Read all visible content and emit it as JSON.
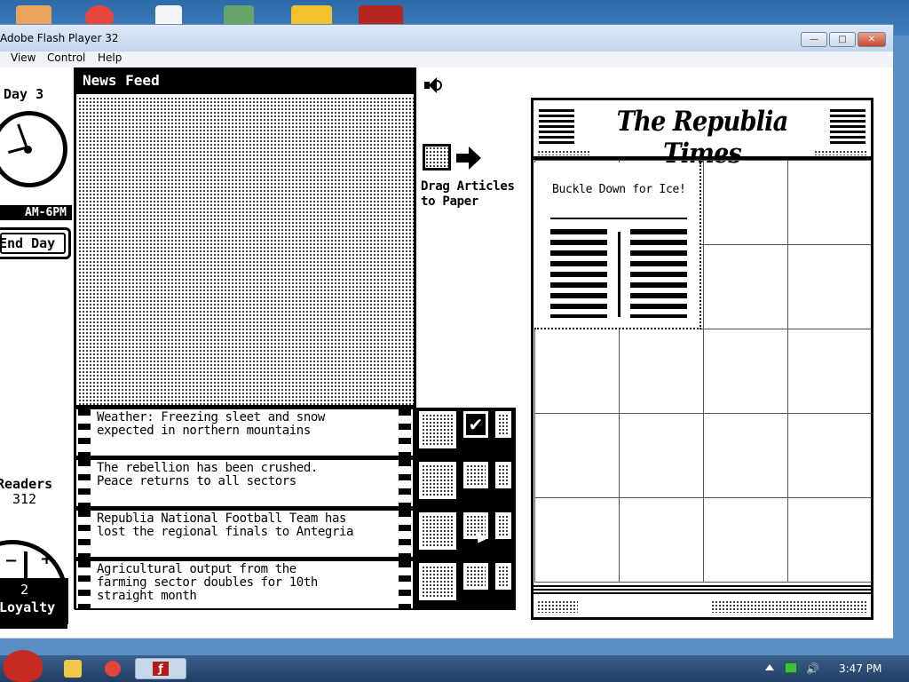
{
  "window": {
    "title": "Adobe Flash Player 32",
    "min_label": "—",
    "max_label": "□",
    "close_label": "✕"
  },
  "menu": [
    "View",
    "Control",
    "Help"
  ],
  "left_panel": {
    "day": "Day 3",
    "time_range": "AM-6PM",
    "end_day_label": "End Day",
    "readers_label": "Readers",
    "readers_count": "312",
    "loyalty_value": "2",
    "loyalty_label": "Loyalty"
  },
  "news_feed": {
    "title": "News Feed",
    "articles": [
      {
        "line1": "Weather: Freezing sleet and snow",
        "line2": "expected in northern mountains",
        "line3": ""
      },
      {
        "line1": "The rebellion has been crushed.",
        "line2": "Peace returns to all sectors",
        "line3": ""
      },
      {
        "line1": "Republia National Football Team has",
        "line2": "lost the regional finals to Antegria",
        "line3": ""
      },
      {
        "line1": "Agricultural output from the",
        "line2": "farming sector doubles for 10th",
        "line3": "straight month"
      }
    ]
  },
  "instructions": {
    "line1": "Drag Articles",
    "line2": "to Paper"
  },
  "paper": {
    "masthead": "The Republia Times",
    "headline": "Buckle Down for Ice!"
  },
  "taskbar": {
    "clock": "3:47 PM"
  },
  "colors": {
    "accent": "#000000",
    "page": "#ffffff",
    "titlebar": "#c4d6ec"
  },
  "icons": {
    "speaker": "speaker-icon",
    "arrow": "right-arrow-icon",
    "check": "check-icon"
  }
}
